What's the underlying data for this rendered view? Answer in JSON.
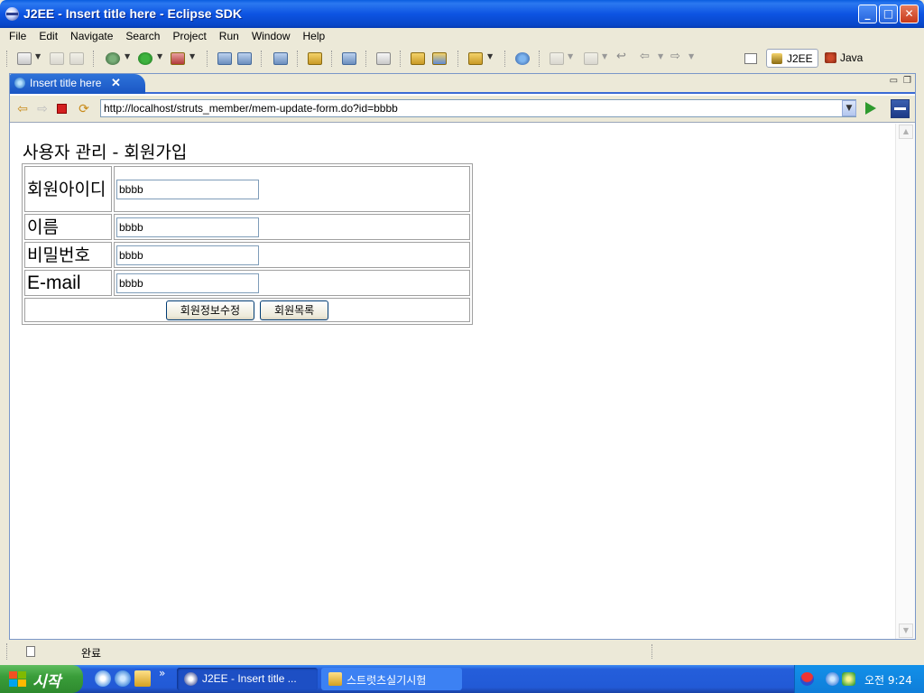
{
  "window": {
    "title": "J2EE - Insert title here - Eclipse SDK",
    "controls": {
      "minimize": "_",
      "maximize": "□",
      "close": "✕"
    }
  },
  "menu": {
    "items": [
      "File",
      "Edit",
      "Navigate",
      "Search",
      "Project",
      "Run",
      "Window",
      "Help"
    ]
  },
  "perspectives": {
    "active": "J2EE",
    "other": "Java"
  },
  "editor": {
    "tab_label": "Insert title here",
    "tab_close": "✕",
    "url": "http://localhost/struts_member/mem-update-form.do?id=bbbb"
  },
  "page": {
    "heading": "사용자 관리 - 회원가입",
    "fields": [
      {
        "label": "회원아이디",
        "value": "bbbb"
      },
      {
        "label": "이름",
        "value": "bbbb"
      },
      {
        "label": "비밀번호",
        "value": "bbbb"
      },
      {
        "label": "E-mail",
        "value": "bbbb"
      }
    ],
    "buttons": {
      "update": "회원정보수정",
      "list": "회원목록"
    }
  },
  "status": {
    "text": "완료"
  },
  "taskbar": {
    "start_label": "시작",
    "overflow": "»",
    "tasks": [
      {
        "label": "J2EE - Insert title ..."
      },
      {
        "label": "스트럿츠실기시험"
      }
    ],
    "clock": "오전 9:24"
  }
}
